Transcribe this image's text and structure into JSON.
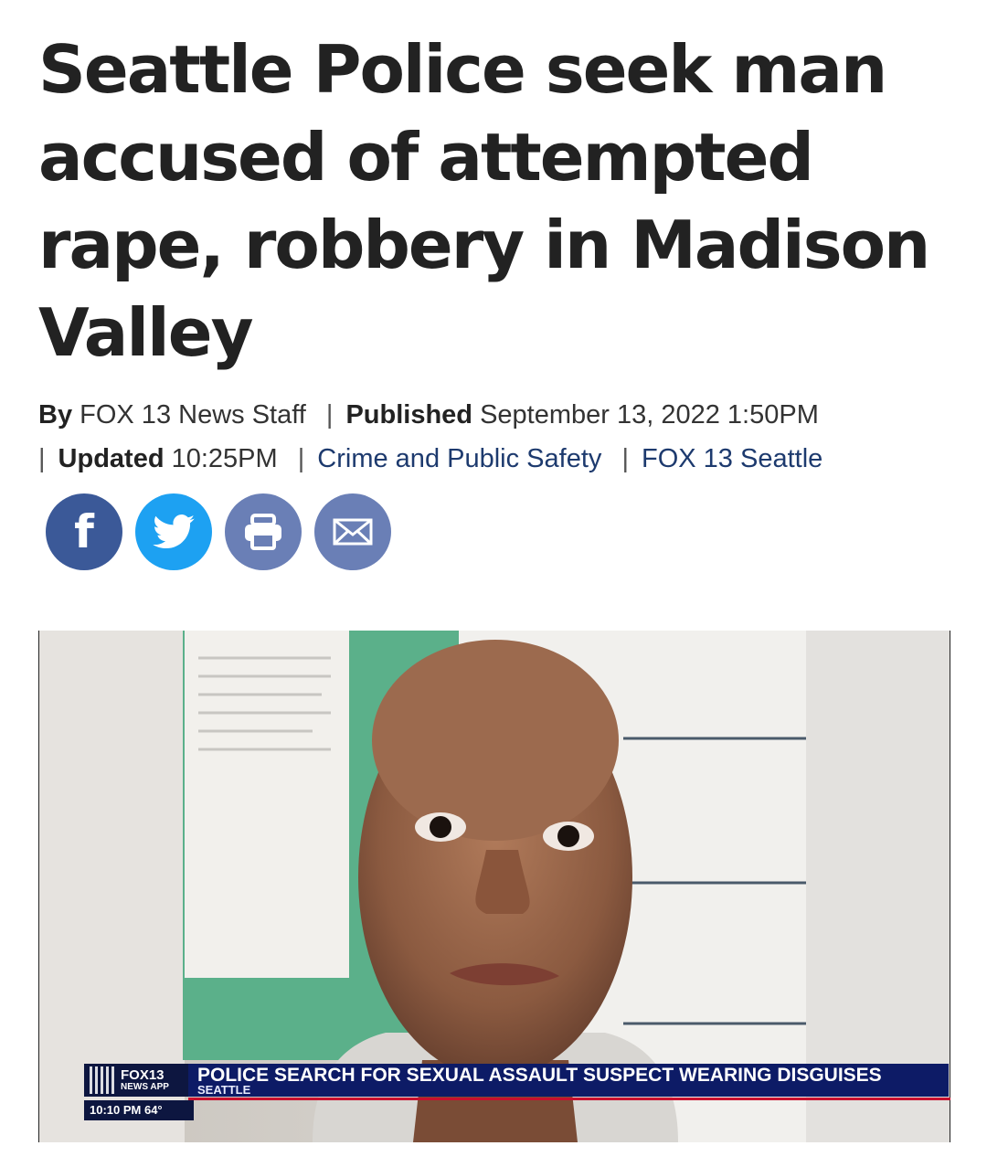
{
  "article": {
    "headline": "Seattle Police seek man accused of attempted rape, robbery in Madison Valley",
    "byline": {
      "by_label": "By",
      "author": "FOX 13 News Staff",
      "published_label": "Published",
      "published_date": "September 13, 2022 1:50PM",
      "updated_label": "Updated",
      "updated_time": "10:25PM",
      "category_link": "Crime and Public Safety",
      "source_link": "FOX 13 Seattle",
      "separator": "|"
    }
  },
  "share": {
    "facebook_icon": "facebook-icon",
    "twitter_icon": "twitter-icon",
    "print_icon": "print-icon",
    "email_icon": "email-icon",
    "facebook_glyph": "f",
    "colors": {
      "facebook": "#3b5998",
      "twitter": "#1da1f2",
      "print": "#6a7fb6",
      "email": "#6a7fb6"
    }
  },
  "video": {
    "lower_third": {
      "brand": "FOX13",
      "brand_sub": "NEWS APP",
      "headline": "POLICE SEARCH FOR SEXUAL ASSAULT SUSPECT WEARING DISGUISES",
      "location": "SEATTLE",
      "time_temp": "10:10 PM  64°"
    },
    "colors": {
      "bar": "#0d1b66",
      "rule": "#c8102e"
    }
  }
}
